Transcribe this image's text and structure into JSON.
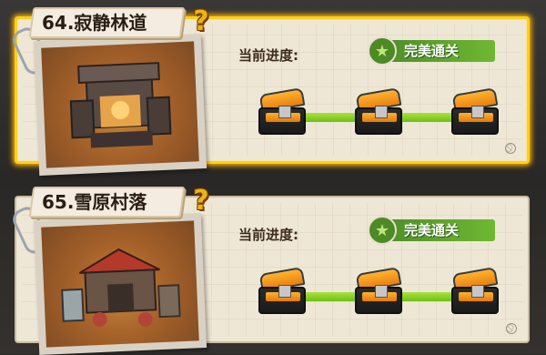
{
  "levels": [
    {
      "title": "64.寂静林道",
      "help_glyph": "?",
      "progress_label": "当前进度:",
      "status_label": "完美通关",
      "selected": true,
      "chests_count": 3
    },
    {
      "title": "65.雪原村落",
      "help_glyph": "?",
      "progress_label": "当前进度:",
      "status_label": "完美通关",
      "selected": false,
      "chests_count": 3
    }
  ],
  "colors": {
    "highlight_border": "#ffd01a",
    "status_green": "#4f8f2a",
    "progress_green": "#8fd62a",
    "chest_orange": "#f59a1c"
  },
  "icons": {
    "help": "question-mark-icon",
    "status": "star-badge-icon",
    "chest": "treasure-chest-icon",
    "clip": "paperclip-icon",
    "ban": "prohibit-icon"
  }
}
